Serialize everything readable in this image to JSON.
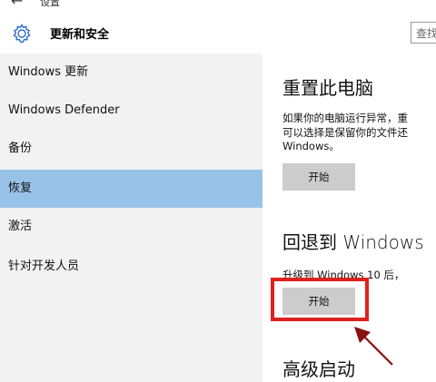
{
  "window": {
    "back_glyph": "←",
    "title": "设置"
  },
  "header": {
    "icon": "gear-icon",
    "title": "更新和安全",
    "search_placeholder": "查找"
  },
  "sidebar": {
    "items": [
      {
        "label": "Windows 更新",
        "selected": false
      },
      {
        "label": "Windows Defender",
        "selected": false
      },
      {
        "label": "备份",
        "selected": false
      },
      {
        "label": "恢复",
        "selected": true
      },
      {
        "label": "激活",
        "selected": false
      },
      {
        "label": "针对开发人员",
        "selected": false
      }
    ]
  },
  "main": {
    "reset": {
      "title": "重置此电脑",
      "desc_line1": "如果你的电脑运行异常，重",
      "desc_line2": "可以选择是保留你的文件还",
      "desc_line3": "Windows。",
      "button": "开始"
    },
    "rollback": {
      "title": "回退到 Windows",
      "desc": "升级到 Windows 10 后，",
      "button": "开始"
    },
    "advanced": {
      "title": "高级启动"
    }
  },
  "colors": {
    "sidebar_bg": "#f2f2f2",
    "selected_bg": "#99c2e8",
    "button_bg": "#cccccc",
    "annotation_red": "#e02020",
    "arrow_dark_red": "#8b1010"
  }
}
